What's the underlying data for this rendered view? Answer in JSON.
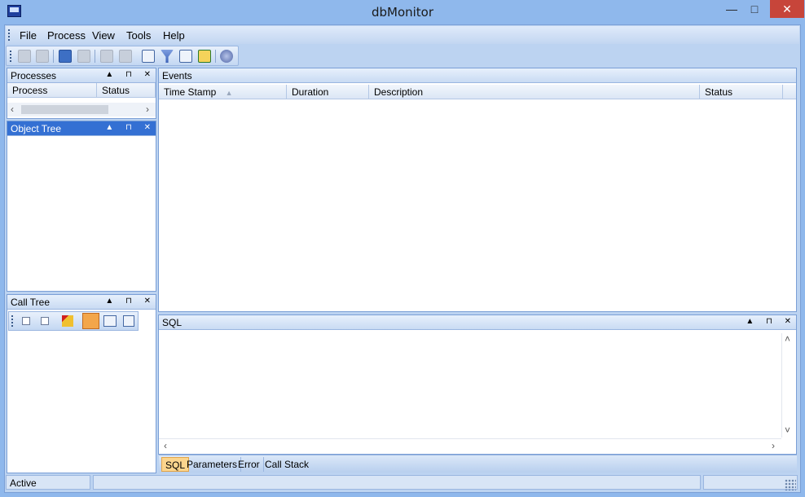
{
  "window": {
    "title": "dbMonitor",
    "min": "—",
    "max": "□",
    "close": "✕"
  },
  "menu": [
    {
      "label": "File"
    },
    {
      "label": "Process"
    },
    {
      "label": "View"
    },
    {
      "label": "Tools"
    },
    {
      "label": "Help"
    }
  ],
  "toolbar": {
    "buttons": [
      "save-icon",
      "export-icon",
      "stop-icon",
      "pause-icon",
      "clear-icon",
      "play-icon",
      "list-icon",
      "filter-icon",
      "settings-grid-icon",
      "refresh-icon",
      "help-icon"
    ]
  },
  "processes": {
    "title": "Processes",
    "columns": [
      "Process",
      "Status"
    ]
  },
  "object_tree": {
    "title": "Object Tree"
  },
  "call_tree": {
    "title": "Call Tree"
  },
  "events": {
    "title": "Events",
    "columns": [
      "Time Stamp",
      "Duration",
      "Description",
      "Status"
    ]
  },
  "sql": {
    "title": "SQL"
  },
  "tabs": [
    "SQL",
    "Parameters",
    "Error",
    "Call Stack"
  ],
  "status": {
    "text": "Active"
  },
  "panel_icons": "▲ ⊓ ✕",
  "arrows": {
    "left": "‹",
    "right": "›",
    "up": "˄",
    "down": "˅"
  },
  "colors": {
    "accent": "#3470d3",
    "frame": "#8fb8ec",
    "tab_active": "#fbd58e",
    "close_button": "#c7453a"
  }
}
